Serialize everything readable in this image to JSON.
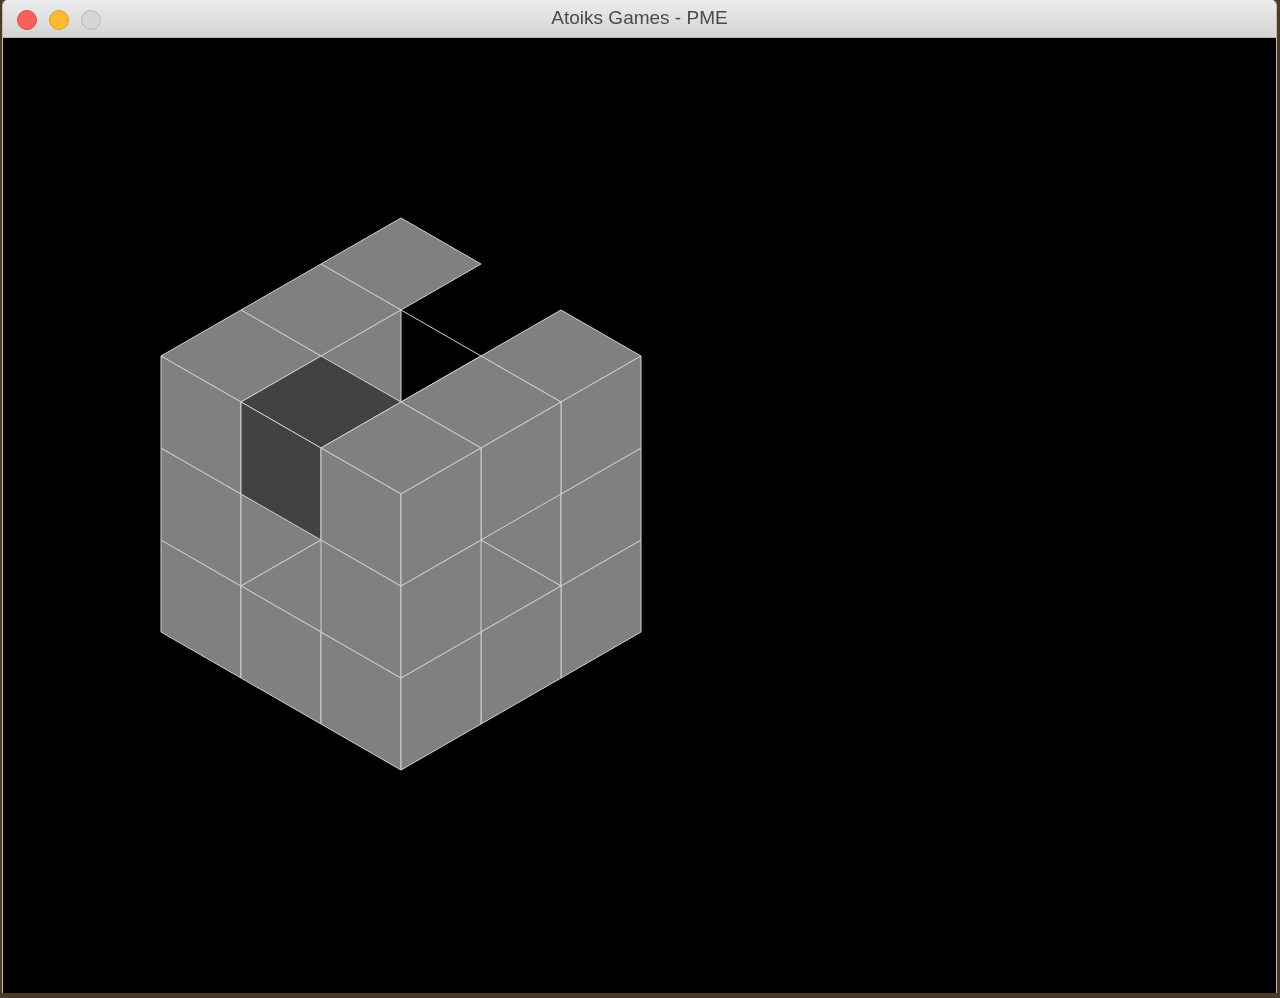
{
  "window": {
    "title": "Atoiks Games - PME"
  },
  "window_controls": [
    {
      "kind": "close",
      "disabled": false
    },
    {
      "kind": "minimize",
      "disabled": false
    },
    {
      "kind": "zoom",
      "disabled": true
    }
  ]
}
